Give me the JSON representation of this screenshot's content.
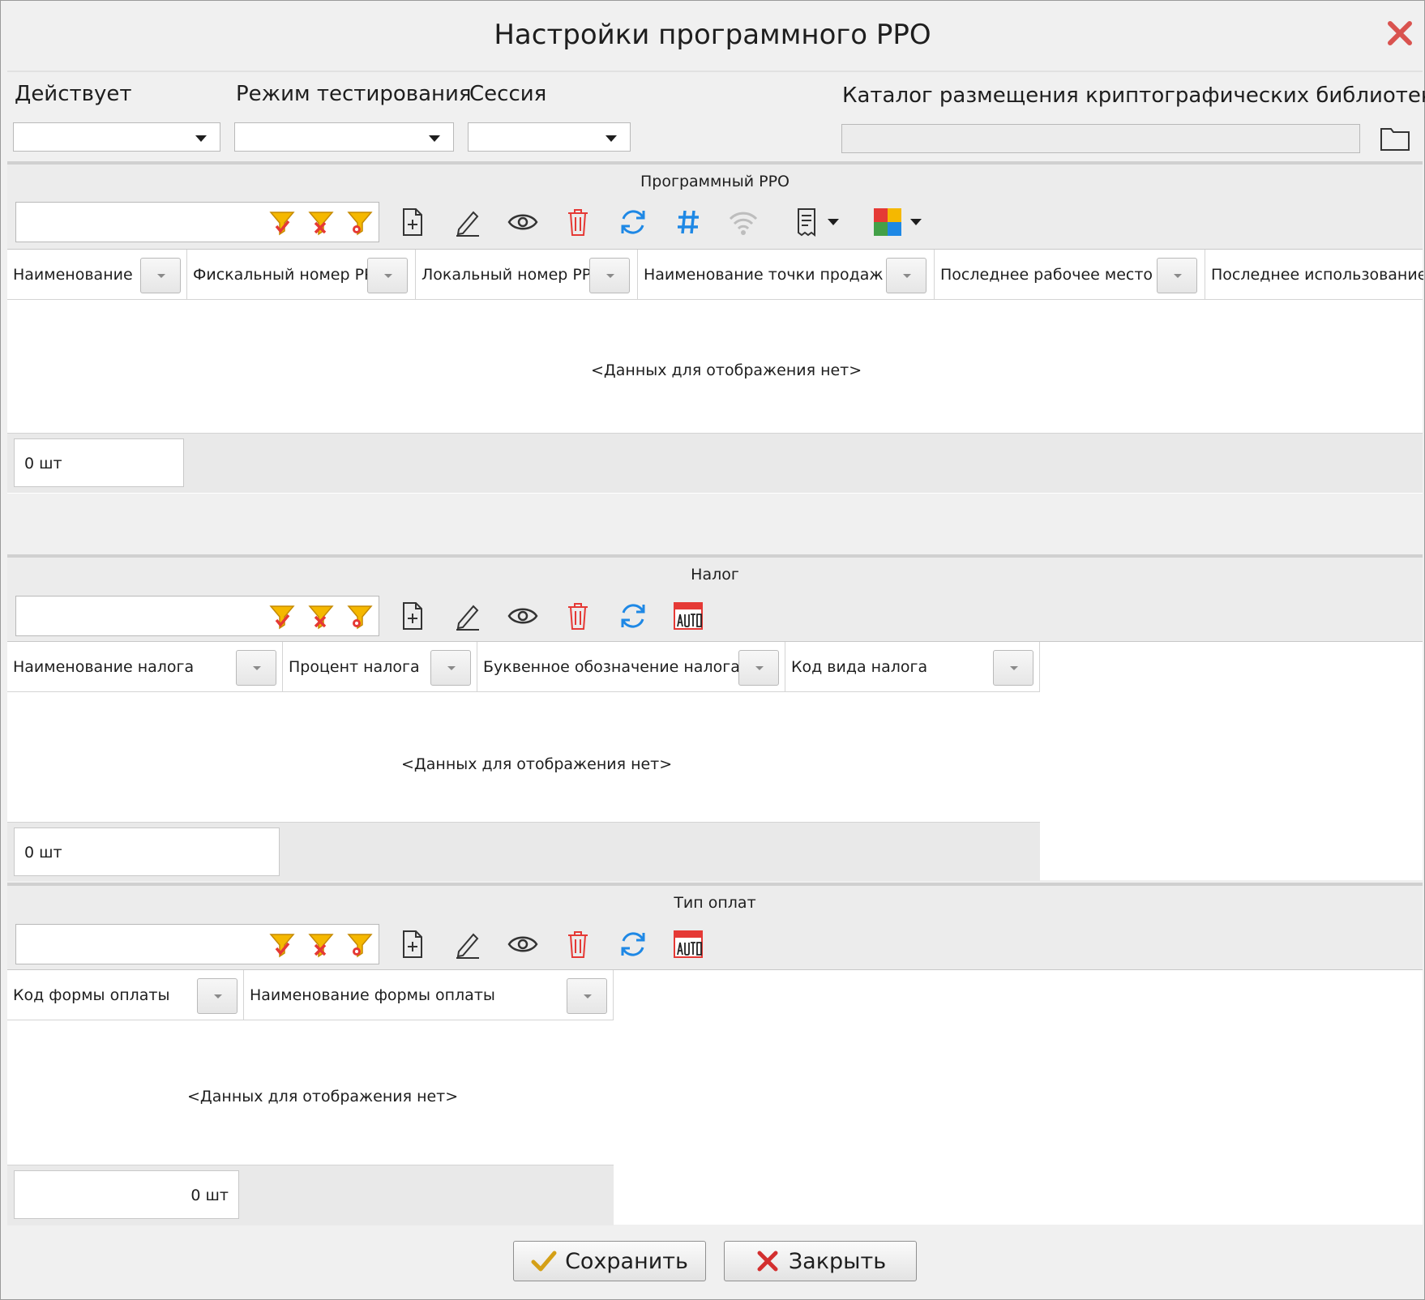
{
  "window": {
    "title": "Настройки программного РРО"
  },
  "settings": {
    "active_label": "Действует",
    "active_value": "",
    "test_mode_label": "Режим тестирования",
    "test_mode_value": "",
    "session_label": "Сессия",
    "session_value": "",
    "crypto_dir_label": "Каталог размещения криптографических библиотек",
    "crypto_dir_value": ""
  },
  "panels": {
    "rro": {
      "caption": "Программный РРО",
      "columns": [
        "Наименование",
        "Фискальный номер РР",
        "Локальный номер РРО",
        "Наименование точки продаж",
        "Последнее рабочее место",
        "Последнее использование"
      ],
      "empty_text": "<Данных для отображения нет>",
      "count": "0 шт"
    },
    "tax": {
      "caption": "Налог",
      "columns": [
        "Наименование налога",
        "Процент налога",
        "Буквенное обозначение налога",
        "Код вида налога"
      ],
      "empty_text": "<Данных для отображения нет>",
      "count": "0 шт"
    },
    "payment": {
      "caption": "Тип оплат",
      "columns": [
        "Код формы оплаты",
        "Наименование формы оплаты"
      ],
      "empty_text": "<Данных для отображения нет>",
      "count": "0 шт"
    }
  },
  "buttons": {
    "save_label": "Сохранить",
    "close_label": "Закрыть"
  },
  "colors": {
    "delete": "#e53935",
    "refresh": "#1e88e5",
    "filter": "#f5b800",
    "close": "#d32f2f"
  }
}
